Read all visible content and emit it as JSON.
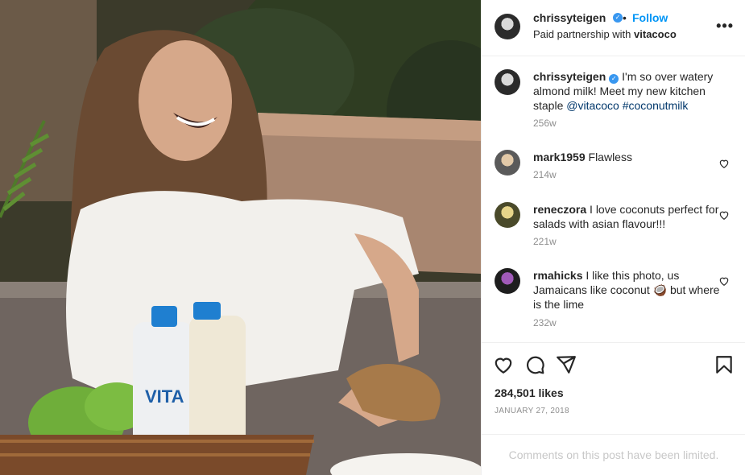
{
  "photo": {
    "alt": ""
  },
  "header": {
    "username": "chrissyteigen",
    "separator": "•",
    "follow_label": "Follow",
    "partnership_prefix": "Paid partnership with",
    "partner": "vitacoco",
    "more_label": "•••"
  },
  "caption": {
    "username": "chrissyteigen",
    "text": "I'm so over watery almond milk! Meet my new kitchen staple",
    "mention": "@vitacoco",
    "hashtag": "#coconutmilk",
    "time": "256w"
  },
  "comments": [
    {
      "username": "mark1959",
      "text": "Flawless",
      "time": "214w"
    },
    {
      "username": "reneczora",
      "text": "I love coconuts perfect for salads with asian flavour!!!",
      "time": "221w"
    },
    {
      "username": "rmahicks",
      "text": "I like this photo, us Jamaicans like coconut 🥥 but where is the lime",
      "time": "232w"
    }
  ],
  "engagement": {
    "likes": "284,501 likes",
    "date": "JANUARY 27, 2018"
  },
  "footer": {
    "limited_text": "Comments on this post have been limited."
  },
  "icons": [
    "heart-icon",
    "comment-icon",
    "share-icon",
    "bookmark-icon",
    "verified-icon",
    "more-icon"
  ],
  "colors": {
    "link": "#0095f6",
    "verified": "#3897f0",
    "hashtag": "#00376b",
    "muted": "#8e8e8e"
  }
}
